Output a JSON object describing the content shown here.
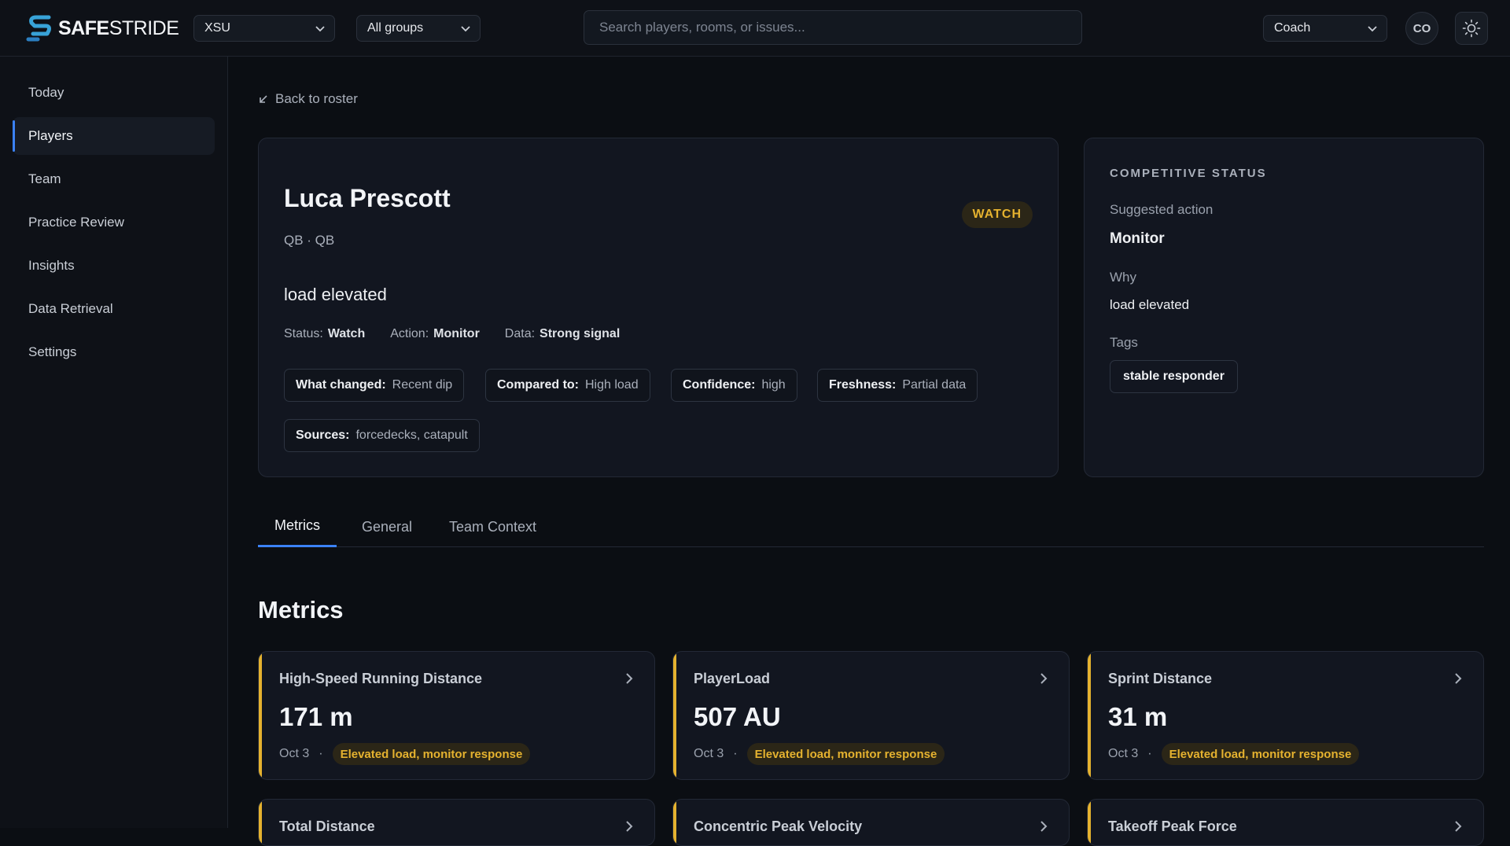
{
  "header": {
    "logo_bold": "SAFE",
    "logo_light": "STRIDE",
    "org_select": "XSU",
    "group_select": "All groups",
    "search_placeholder": "Search players, rooms, or issues...",
    "role_select": "Coach",
    "avatar_initials": "CO",
    "theme_icon": "sun-icon"
  },
  "sidebar": {
    "items": [
      {
        "label": "Today"
      },
      {
        "label": "Players",
        "active": true
      },
      {
        "label": "Team"
      },
      {
        "label": "Practice Review"
      },
      {
        "label": "Insights"
      },
      {
        "label": "Data Retrieval"
      },
      {
        "label": "Settings"
      }
    ]
  },
  "back_link": "Back to roster",
  "player": {
    "name": "Luca Prescott",
    "position": "QB · QB",
    "badge": "WATCH",
    "summary": "load elevated",
    "status_label": "Status:",
    "status_value": "Watch",
    "action_label": "Action:",
    "action_value": "Monitor",
    "data_label": "Data:",
    "data_value": "Strong signal",
    "chips": [
      {
        "label": "What changed:",
        "value": "Recent dip"
      },
      {
        "label": "Compared to:",
        "value": "High load"
      },
      {
        "label": "Confidence:",
        "value": "high"
      },
      {
        "label": "Freshness:",
        "value": "Partial data"
      },
      {
        "label": "Sources:",
        "value": "forcedecks, catapult"
      }
    ]
  },
  "competitive": {
    "title": "COMPETITIVE STATUS",
    "suggested_label": "Suggested action",
    "suggested_value": "Monitor",
    "why_label": "Why",
    "why_value": "load elevated",
    "tags_label": "Tags",
    "tags": [
      "stable responder"
    ]
  },
  "tabs": [
    {
      "label": "Metrics",
      "active": true
    },
    {
      "label": "General"
    },
    {
      "label": "Team Context"
    }
  ],
  "metrics_title": "Metrics",
  "metrics": [
    {
      "name": "High-Speed Running Distance",
      "value": "171 m",
      "date": "Oct 3",
      "note": "Elevated load, monitor response"
    },
    {
      "name": "PlayerLoad",
      "value": "507 AU",
      "date": "Oct 3",
      "note": "Elevated load, monitor response"
    },
    {
      "name": "Sprint Distance",
      "value": "31 m",
      "date": "Oct 3",
      "note": "Elevated load, monitor response"
    },
    {
      "name": "Total Distance"
    },
    {
      "name": "Concentric Peak Velocity"
    },
    {
      "name": "Takeoff Peak Force"
    }
  ],
  "colors": {
    "accent": "#3b82f6",
    "watch": "#e5b22f",
    "background": "#0b0e13"
  }
}
